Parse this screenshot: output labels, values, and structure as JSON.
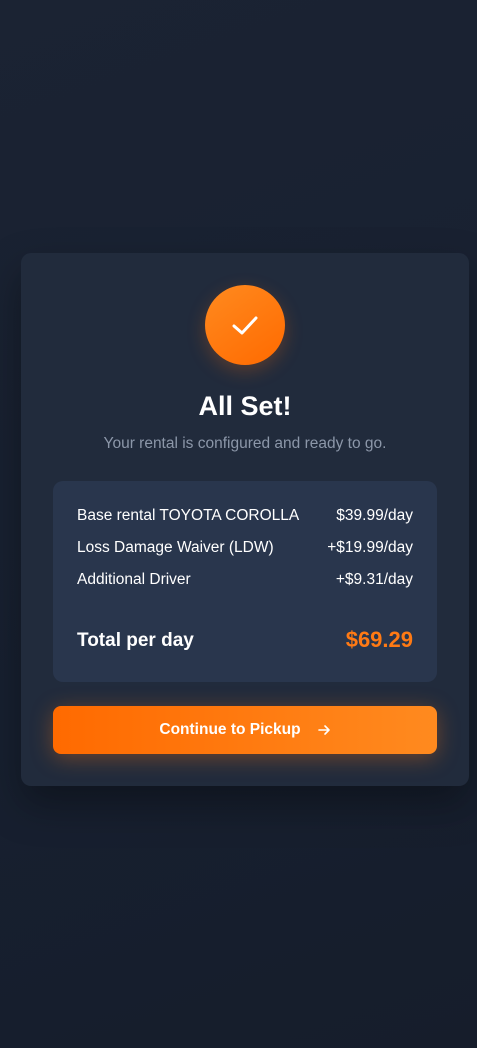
{
  "confirmation": {
    "title": "All Set!",
    "subtitle": "Your rental is configured and ready to go."
  },
  "summary": {
    "items": [
      {
        "label": "Base rental TOYOTA COROLLA",
        "price": "$39.99/day"
      },
      {
        "label": "Loss Damage Waiver (LDW)",
        "price": "+$19.99/day"
      },
      {
        "label": "Additional Driver",
        "price": "+$9.31/day"
      }
    ],
    "total_label": "Total per day",
    "total_value": "$69.29"
  },
  "actions": {
    "continue_label": "Continue to Pickup"
  },
  "colors": {
    "accent": "#ff7a14",
    "background": "#1a2231",
    "card": "#212b3c",
    "summary_panel": "#29364d"
  },
  "icons": {
    "success": "checkmark-icon",
    "continue": "arrow-right-icon"
  }
}
